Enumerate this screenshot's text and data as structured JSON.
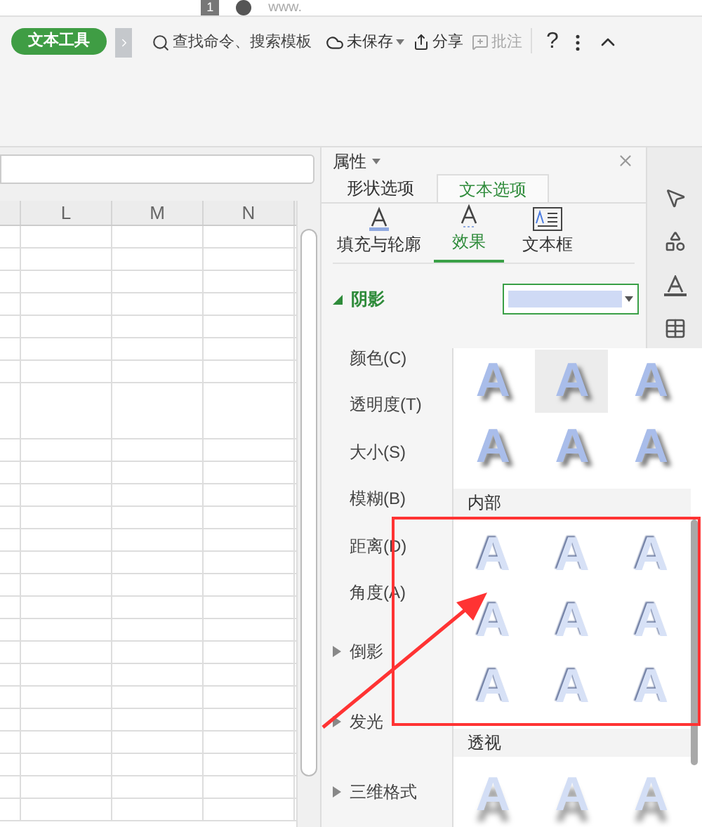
{
  "title_bar": {
    "badge": "1",
    "account": "www."
  },
  "toolbar": {
    "context_tab": "文本工具",
    "search_placeholder": "查找命令、搜索模板",
    "save_status": "未保存",
    "share": "分享",
    "comment": {
      "label": "批注",
      "disabled": true
    },
    "help": "?"
  },
  "sheet": {
    "columns": [
      "",
      "L",
      "M",
      "N"
    ]
  },
  "panel": {
    "title": "属性",
    "tabs": [
      {
        "label": "形状选项",
        "selected": false
      },
      {
        "label": "文本选项",
        "selected": true
      }
    ],
    "subtabs": [
      {
        "label": "填充与轮廓",
        "kind": "fill",
        "selected": false
      },
      {
        "label": "效果",
        "kind": "effect",
        "selected": true
      },
      {
        "label": "文本框",
        "kind": "textbox",
        "selected": false
      }
    ],
    "sections": [
      {
        "label": "阴影",
        "expanded": true,
        "properties": [
          "颜色(C)",
          "透明度(T)",
          "大小(S)",
          "模糊(B)",
          "距离(D)",
          "角度(A)"
        ]
      },
      {
        "label": "倒影",
        "expanded": false
      },
      {
        "label": "发光",
        "expanded": false
      },
      {
        "label": "三维格式",
        "expanded": false
      }
    ]
  },
  "gallery": {
    "groups": [
      {
        "kind": "outer",
        "rows": [
          [
            {
              "label": "A",
              "selected": false
            },
            {
              "label": "A",
              "selected": true
            },
            {
              "label": "A",
              "selected": false
            }
          ],
          [
            {
              "label": "A",
              "selected": false
            },
            {
              "label": "A",
              "selected": false
            },
            {
              "label": "A",
              "selected": false
            }
          ]
        ]
      },
      {
        "kind": "inner",
        "heading": "内部",
        "rows": [
          [
            {
              "label": "A",
              "selected": false
            },
            {
              "label": "A",
              "selected": false
            },
            {
              "label": "A",
              "selected": false
            }
          ],
          [
            {
              "label": "A",
              "selected": false
            },
            {
              "label": "A",
              "selected": false
            },
            {
              "label": "A",
              "selected": false
            }
          ],
          [
            {
              "label": "A",
              "selected": false
            },
            {
              "label": "A",
              "selected": false
            },
            {
              "label": "A",
              "selected": false
            }
          ]
        ]
      },
      {
        "kind": "perspective",
        "heading": "透视",
        "rows": [
          [
            {
              "label": "A",
              "selected": false
            },
            {
              "label": "A",
              "selected": false
            },
            {
              "label": "A",
              "selected": false
            }
          ]
        ]
      }
    ]
  }
}
